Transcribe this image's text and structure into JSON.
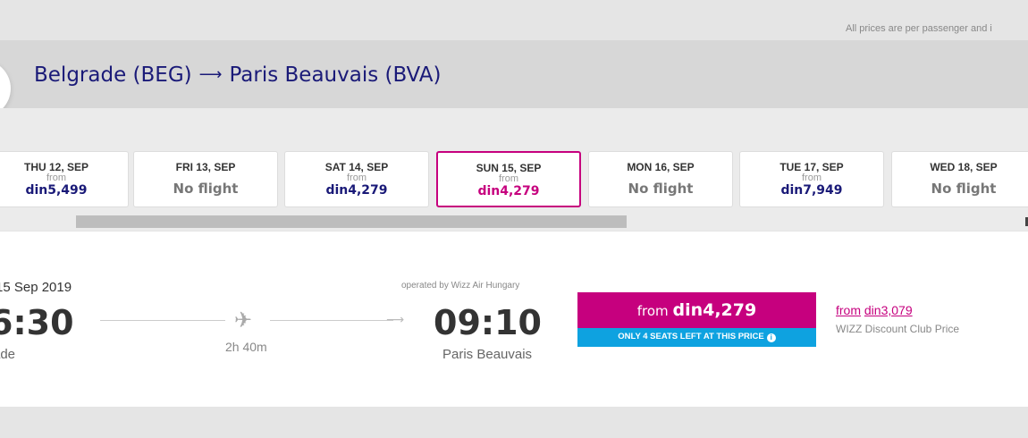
{
  "disclaimer": "All prices are per passenger and i",
  "route": {
    "origin": "Belgrade (BEG)",
    "arrow": "⟶",
    "destination": "Paris Beauvais (BVA)"
  },
  "dates": [
    {
      "day": "THU 12, SEP",
      "from": "from",
      "price": "din5,499",
      "no_flight": ""
    },
    {
      "day": "FRI 13, SEP",
      "from": "",
      "price": "",
      "no_flight": "No flight"
    },
    {
      "day": "SAT 14, SEP",
      "from": "from",
      "price": "din4,279",
      "no_flight": ""
    },
    {
      "day": "SUN 15, SEP",
      "from": "from",
      "price": "din4,279",
      "no_flight": ""
    },
    {
      "day": "MON 16, SEP",
      "from": "",
      "price": "",
      "no_flight": "No flight"
    },
    {
      "day": "TUE 17, SEP",
      "from": "from",
      "price": "din7,949",
      "no_flight": ""
    },
    {
      "day": "WED 18, SEP",
      "from": "",
      "price": "",
      "no_flight": "No flight"
    }
  ],
  "selected_date_index": 3,
  "flight": {
    "date": "15 Sep 2019",
    "departure_time": "6:30",
    "departure_city": "ade",
    "duration": "2h 40m",
    "operated_by": "operated by Wizz Air Hungary",
    "arrival_time": "09:10",
    "arrival_city": "Paris Beauvais"
  },
  "fare": {
    "from_label": "from",
    "price": "din4,279",
    "seats_notice": "ONLY 4 SEATS LEFT AT THIS PRICE",
    "info_glyph": "i"
  },
  "club": {
    "from_label": "from",
    "price": "din3,079",
    "label": "WIZZ Discount Club Price"
  },
  "icons": {
    "plane": "✈",
    "line_arrow": "⟶"
  },
  "colors": {
    "brand_navy": "#1a1a78",
    "brand_magenta": "#c6007e",
    "info_blue": "#0ea2e0"
  }
}
